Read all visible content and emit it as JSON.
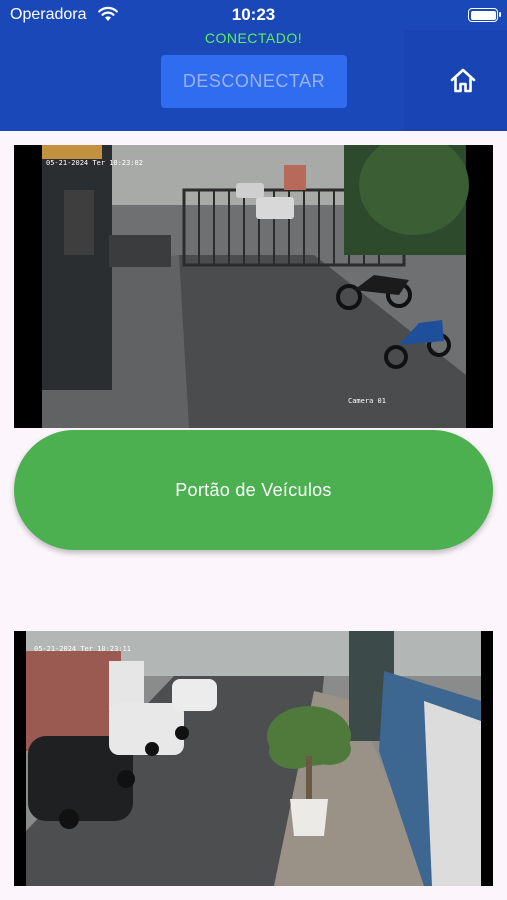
{
  "status_bar": {
    "carrier": "Operadora",
    "time": "10:23"
  },
  "header": {
    "connection_status": "CONECTADO!",
    "disconnect_label": "DESCONECTAR",
    "home_icon": "home-icon"
  },
  "cameras": [
    {
      "timestamp": "05-21-2024 Ter 10:23:02",
      "camera_label": "Camera 01"
    },
    {
      "timestamp": "05-21-2024 Ter 10:23:11"
    }
  ],
  "gate_button": {
    "label": "Portão de Veículos"
  },
  "colors": {
    "header_bg": "#1a48b8",
    "connected": "#5cf05c",
    "disconnect_button": "#2f6cf0",
    "gate_button": "#4caf50",
    "page_bg": "#fcf6fc"
  }
}
